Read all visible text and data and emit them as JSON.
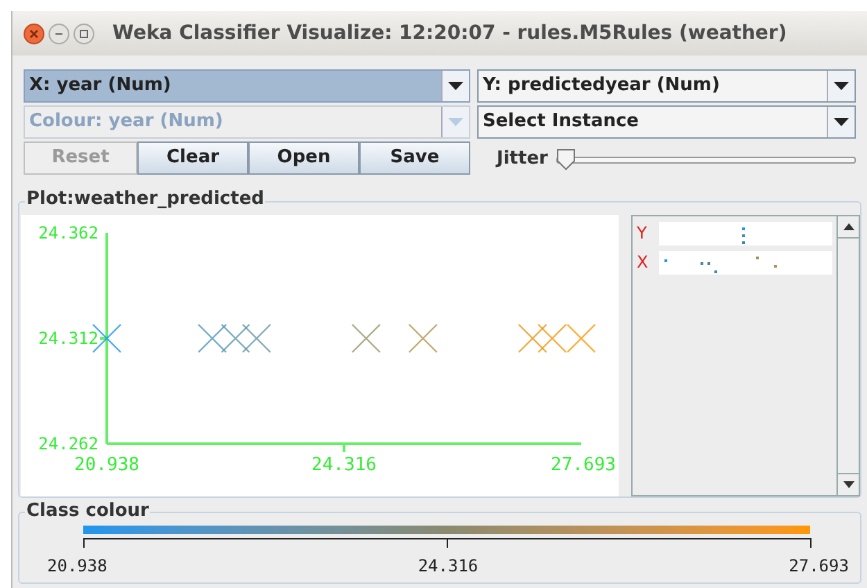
{
  "window": {
    "title": "Weka Classifier Visualize: 12:20:07 - rules.M5Rules (weather)"
  },
  "combos": [
    {
      "value": "X: year (Num)",
      "focused": true,
      "disabled": false
    },
    {
      "value": "Y: predictedyear (Num)",
      "focused": false,
      "disabled": false
    },
    {
      "value": "Colour: year (Num)",
      "focused": false,
      "disabled": true
    },
    {
      "value": "Select Instance",
      "focused": false,
      "disabled": false
    }
  ],
  "buttons": [
    {
      "label": "Reset",
      "disabled": true
    },
    {
      "label": "Clear",
      "disabled": false
    },
    {
      "label": "Open",
      "disabled": false
    },
    {
      "label": "Save",
      "disabled": false
    }
  ],
  "jitter": {
    "label": "Jitter",
    "level": 0
  },
  "plot": {
    "title": "Plot:weather_predicted",
    "chart_data": {
      "type": "scatter",
      "x": [
        20.938,
        22.44,
        22.77,
        23.07,
        24.63,
        25.44,
        27.0,
        27.28,
        27.693
      ],
      "series": [
        {
          "values": [
            24.312,
            24.312,
            24.312,
            24.312,
            24.312,
            24.312,
            24.312,
            24.312,
            24.312
          ]
        }
      ],
      "xlim": [
        20.938,
        27.693
      ],
      "ylim": [
        24.262,
        24.362
      ],
      "xticks": [
        20.938,
        24.316,
        27.693
      ],
      "yticks": [
        24.262,
        24.312,
        24.362
      ]
    }
  },
  "attribute_panel": {
    "rows": [
      {
        "label": "Y"
      },
      {
        "label": "X"
      }
    ]
  },
  "class_colour": {
    "title": "Class colour",
    "labels": [
      "20.938",
      "24.316",
      "27.693"
    ]
  }
}
